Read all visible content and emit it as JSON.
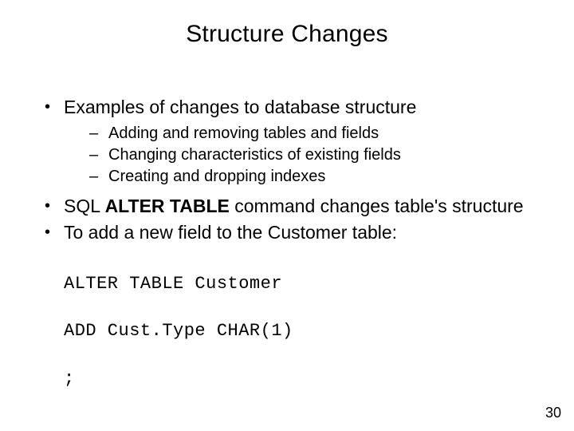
{
  "title": "Structure Changes",
  "bullets": {
    "b1": "Examples of changes to database structure",
    "b1_sub": {
      "s1": "Adding and removing tables and fields",
      "s2": "Changing characteristics of existing fields",
      "s3": "Creating and dropping indexes"
    },
    "b2_pre": "SQL ",
    "b2_bold": "ALTER TABLE",
    "b2_post": " command changes table's structure",
    "b3": "To add a new field to the Customer table:"
  },
  "code": {
    "l1": "ALTER TABLE Customer",
    "l2": "ADD Cust.Type CHAR(1)",
    "l3": ";"
  },
  "page_number": "30"
}
